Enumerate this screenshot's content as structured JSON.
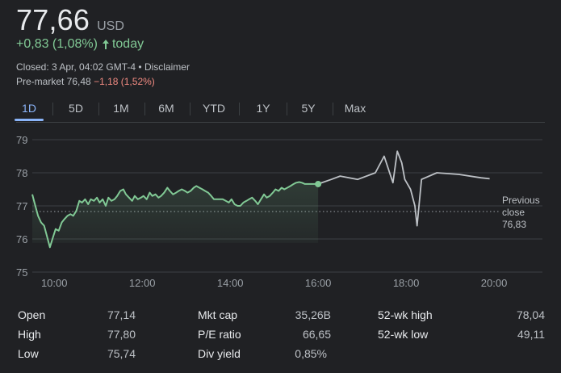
{
  "quote": {
    "price": "77,66",
    "currency": "USD",
    "change": "+0,83 (1,08%)",
    "change_period": "today",
    "closed_text": "Closed: 3 Apr, 04:02 GMT-4 • Disclaimer",
    "premarket_label": "Pre-market 76,48",
    "premarket_change": "−1,18 (1,52%)"
  },
  "tabs": [
    {
      "label": "1D",
      "active": true
    },
    {
      "label": "5D",
      "active": false
    },
    {
      "label": "1M",
      "active": false
    },
    {
      "label": "6M",
      "active": false
    },
    {
      "label": "YTD",
      "active": false
    },
    {
      "label": "1Y",
      "active": false
    },
    {
      "label": "5Y",
      "active": false
    },
    {
      "label": "Max",
      "active": false
    }
  ],
  "colors": {
    "up": "#81c995",
    "down": "#f28b82",
    "accent": "#8ab4f8",
    "afterhours_line": "#bdc1c6"
  },
  "chart_data": {
    "type": "line",
    "xlabel": "",
    "ylabel": "",
    "x_ticks": [
      "10:00",
      "12:00",
      "14:00",
      "16:00",
      "18:00",
      "20:00"
    ],
    "y_ticks": [
      79,
      78,
      77,
      76,
      75
    ],
    "ylim": [
      75,
      79
    ],
    "xlim_hours": [
      9.5,
      21.1
    ],
    "previous_close_label": [
      "Previous",
      "close",
      "76,83"
    ],
    "previous_close": 76.83,
    "series": [
      {
        "session": "regular",
        "x": [
          9.5,
          9.57,
          9.63,
          9.7,
          9.77,
          9.83,
          9.9,
          9.97,
          10.03,
          10.1,
          10.17,
          10.23,
          10.3,
          10.37,
          10.43,
          10.5,
          10.57,
          10.63,
          10.7,
          10.77,
          10.83,
          10.9,
          10.97,
          11.03,
          11.1,
          11.17,
          11.23,
          11.3,
          11.37,
          11.43,
          11.5,
          11.57,
          11.63,
          11.7,
          11.77,
          11.83,
          11.9,
          11.97,
          12.03,
          12.1,
          12.17,
          12.23,
          12.3,
          12.37,
          12.43,
          12.5,
          12.57,
          12.63,
          12.7,
          12.77,
          12.83,
          12.9,
          12.97,
          13.03,
          13.1,
          13.17,
          13.23,
          13.3,
          13.37,
          13.43,
          13.5,
          13.57,
          13.63,
          13.7,
          13.77,
          13.83,
          13.9,
          13.97,
          14.03,
          14.1,
          14.17,
          14.23,
          14.3,
          14.37,
          14.43,
          14.5,
          14.57,
          14.63,
          14.7,
          14.77,
          14.83,
          14.9,
          14.97,
          15.03,
          15.1,
          15.17,
          15.23,
          15.3,
          15.37,
          15.43,
          15.5,
          15.57,
          15.63,
          15.7,
          15.77,
          15.83,
          15.9,
          16.0
        ],
        "values": [
          77.35,
          77.0,
          76.7,
          76.5,
          76.4,
          76.1,
          75.75,
          76.05,
          76.3,
          76.25,
          76.5,
          76.6,
          76.7,
          76.75,
          76.7,
          76.85,
          77.15,
          77.1,
          77.2,
          77.05,
          77.2,
          77.15,
          77.25,
          77.1,
          77.2,
          77.0,
          77.25,
          77.15,
          77.2,
          77.3,
          77.45,
          77.5,
          77.35,
          77.25,
          77.15,
          77.3,
          77.2,
          77.25,
          77.3,
          77.2,
          77.4,
          77.3,
          77.35,
          77.25,
          77.3,
          77.4,
          77.55,
          77.45,
          77.35,
          77.4,
          77.45,
          77.5,
          77.45,
          77.4,
          77.45,
          77.55,
          77.6,
          77.55,
          77.5,
          77.45,
          77.4,
          77.3,
          77.2,
          77.2,
          77.2,
          77.2,
          77.15,
          77.1,
          77.2,
          77.05,
          77.0,
          77.0,
          77.1,
          77.15,
          77.2,
          77.25,
          77.15,
          77.05,
          77.2,
          77.35,
          77.25,
          77.3,
          77.4,
          77.5,
          77.45,
          77.55,
          77.5,
          77.55,
          77.6,
          77.65,
          77.7,
          77.72,
          77.7,
          77.66,
          77.66,
          77.66,
          77.66,
          77.66
        ]
      },
      {
        "session": "after-hours",
        "x": [
          16.0,
          16.3,
          16.5,
          16.9,
          17.3,
          17.5,
          17.7,
          17.8,
          17.9,
          17.97,
          18.1,
          18.2,
          18.25,
          18.35,
          18.7,
          19.2,
          19.7,
          19.9
        ],
        "values": [
          77.66,
          77.8,
          77.9,
          77.8,
          78.0,
          78.5,
          77.7,
          78.65,
          78.3,
          77.8,
          77.5,
          77.0,
          76.4,
          77.8,
          78.0,
          77.95,
          77.85,
          77.82
        ]
      }
    ]
  },
  "stats": {
    "col1": [
      {
        "label": "Open",
        "value": "77,14"
      },
      {
        "label": "High",
        "value": "77,80"
      },
      {
        "label": "Low",
        "value": "75,74"
      }
    ],
    "col2": [
      {
        "label": "Mkt cap",
        "value": "35,26B"
      },
      {
        "label": "P/E ratio",
        "value": "66,65"
      },
      {
        "label": "Div yield",
        "value": "0,85%"
      }
    ],
    "col3": [
      {
        "label": "52-wk high",
        "value": "78,04"
      },
      {
        "label": "52-wk low",
        "value": "49,11"
      }
    ]
  }
}
